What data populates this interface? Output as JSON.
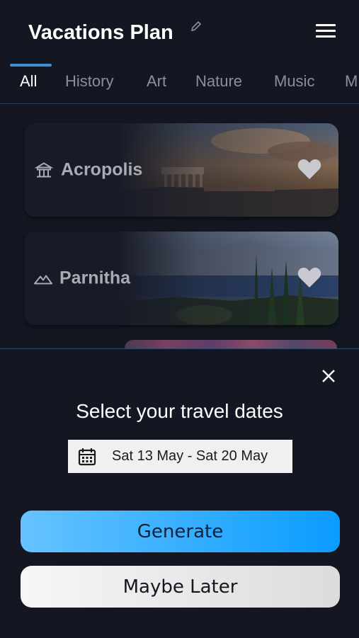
{
  "header": {
    "title": "Vacations Plan"
  },
  "tabs": [
    {
      "label": "All",
      "active": true
    },
    {
      "label": "History",
      "active": false
    },
    {
      "label": "Art",
      "active": false
    },
    {
      "label": "Nature",
      "active": false
    },
    {
      "label": "Music",
      "active": false
    },
    {
      "label": "M",
      "active": false
    }
  ],
  "cards": [
    {
      "title": "Acropolis",
      "icon": "temple-icon",
      "favorite_icon": "heart-icon"
    },
    {
      "title": "Parnitha",
      "icon": "mountain-icon",
      "favorite_icon": "heart-icon"
    }
  ],
  "sheet": {
    "title": "Select your travel dates",
    "date_range": "Sat 13 May - Sat 20 May",
    "generate_label": "Generate",
    "later_label": "Maybe Later"
  },
  "colors": {
    "background": "#141722",
    "accent": "#3c8fd8",
    "generate_start": "#66c3ff",
    "generate_end": "#0a9cff"
  }
}
